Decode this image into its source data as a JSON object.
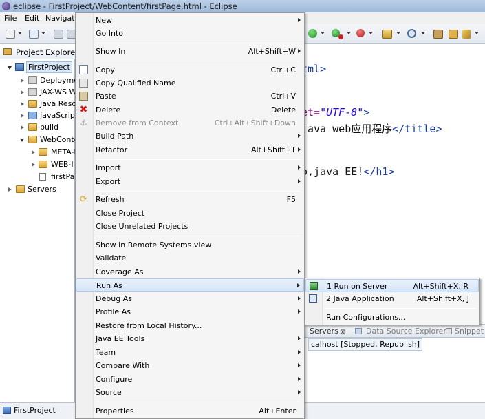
{
  "window": {
    "title": "eclipse - FirstProject/WebContent/firstPage.html - Eclipse"
  },
  "menubar": {
    "file": "File",
    "edit": "Edit",
    "navigate": "Navigat"
  },
  "project_explorer": {
    "title": "Project Explorer",
    "items": [
      {
        "label": "FirstProject"
      },
      {
        "label": "Deployme"
      },
      {
        "label": "JAX-WS W"
      },
      {
        "label": "Java Reso"
      },
      {
        "label": "JavaScript"
      },
      {
        "label": "build"
      },
      {
        "label": "WebConte"
      },
      {
        "label": "META-I"
      },
      {
        "label": "WEB-I"
      },
      {
        "label": "firstPa"
      },
      {
        "label": "Servers"
      }
    ]
  },
  "editor": {
    "line1": "tml>",
    "line2_attr": "et=",
    "line2_value": "\"UTF-8\"",
    "line2_end": ">",
    "line3_text": "java web应用程序",
    "line3_tag": "</title>",
    "line4_text": "o,java EE!",
    "line4_tag": "</h1>"
  },
  "context_menu": {
    "items": [
      {
        "label": "New",
        "shortcut": ""
      },
      {
        "label": "Go Into",
        "shortcut": ""
      },
      {
        "label": "Show In",
        "shortcut": "Alt+Shift+W"
      },
      {
        "label": "Copy",
        "shortcut": "Ctrl+C"
      },
      {
        "label": "Copy Qualified Name",
        "shortcut": ""
      },
      {
        "label": "Paste",
        "shortcut": "Ctrl+V"
      },
      {
        "label": "Delete",
        "shortcut": "Delete"
      },
      {
        "label": "Remove from Context",
        "shortcut": "Ctrl+Alt+Shift+Down"
      },
      {
        "label": "Build Path",
        "shortcut": ""
      },
      {
        "label": "Refactor",
        "shortcut": "Alt+Shift+T"
      },
      {
        "label": "Import",
        "shortcut": ""
      },
      {
        "label": "Export",
        "shortcut": ""
      },
      {
        "label": "Refresh",
        "shortcut": "F5"
      },
      {
        "label": "Close Project",
        "shortcut": ""
      },
      {
        "label": "Close Unrelated Projects",
        "shortcut": ""
      },
      {
        "label": "Show in Remote Systems view",
        "shortcut": ""
      },
      {
        "label": "Validate",
        "shortcut": ""
      },
      {
        "label": "Coverage As",
        "shortcut": ""
      },
      {
        "label": "Run As",
        "shortcut": ""
      },
      {
        "label": "Debug As",
        "shortcut": ""
      },
      {
        "label": "Profile As",
        "shortcut": ""
      },
      {
        "label": "Restore from Local History...",
        "shortcut": ""
      },
      {
        "label": "Java EE Tools",
        "shortcut": ""
      },
      {
        "label": "Team",
        "shortcut": ""
      },
      {
        "label": "Compare With",
        "shortcut": ""
      },
      {
        "label": "Configure",
        "shortcut": ""
      },
      {
        "label": "Source",
        "shortcut": ""
      },
      {
        "label": "Properties",
        "shortcut": "Alt+Enter"
      }
    ]
  },
  "run_as_submenu": {
    "items": [
      {
        "label": "1 Run on Server",
        "shortcut": "Alt+Shift+X, R"
      },
      {
        "label": "2 Java Application",
        "shortcut": "Alt+Shift+X, J"
      },
      {
        "label": "Run Configurations...",
        "shortcut": ""
      }
    ]
  },
  "bottom_panel": {
    "tabs": [
      {
        "label": "Servers"
      },
      {
        "label": "Data Source Explorer"
      },
      {
        "label": "Snippet"
      }
    ],
    "server_entry": "calhost  [Stopped, Republish]"
  },
  "status_bar": {
    "text": "FirstProject"
  }
}
